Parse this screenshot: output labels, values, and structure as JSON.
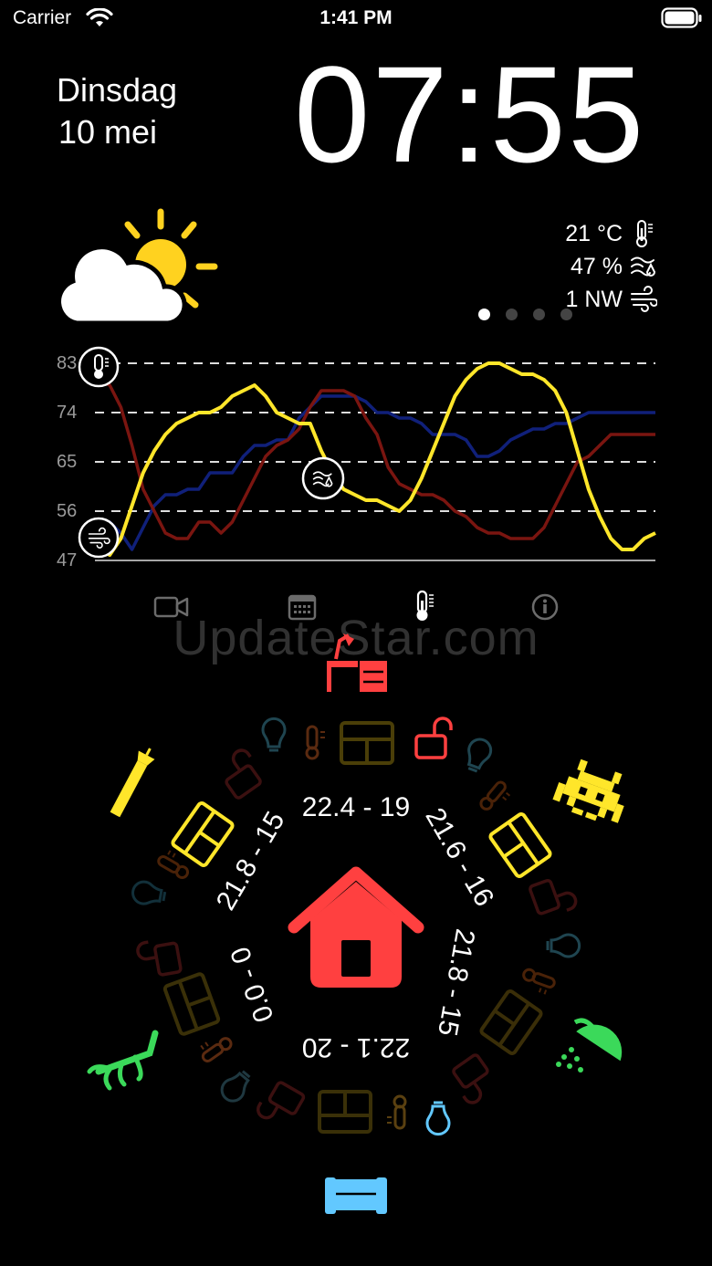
{
  "status_bar": {
    "carrier": "Carrier",
    "time": "1:41 PM"
  },
  "header": {
    "day": "Dinsdag",
    "date": "10 mei",
    "clock": "07:55"
  },
  "weather": {
    "condition_icon": "partly-cloudy-sun-icon",
    "temperature": "21 °C",
    "humidity": "47 %",
    "wind": "1 NW",
    "pager_pages": 4,
    "pager_active": 0
  },
  "chart_data": {
    "type": "line",
    "y_ticks": [
      "83",
      "74",
      "65",
      "56",
      "47"
    ],
    "ylim": [
      47,
      83
    ],
    "grid": "dashed-horizontal",
    "series": [
      {
        "color": "#ffe62a",
        "values": [
          49,
          48,
          51,
          57,
          63,
          67,
          70,
          72,
          73,
          74,
          74,
          75,
          77,
          78,
          79,
          77,
          74,
          73,
          72,
          72,
          67,
          63,
          60,
          59,
          58,
          58,
          57,
          56,
          58,
          62,
          67,
          72,
          77,
          80,
          82,
          83,
          83,
          82,
          81,
          81,
          80,
          78,
          74,
          67,
          60,
          55,
          51,
          49,
          49,
          51,
          52
        ]
      },
      {
        "color": "#7a1510",
        "values": [
          80,
          79,
          75,
          68,
          60,
          56,
          52,
          51,
          51,
          54,
          54,
          52,
          54,
          58,
          62,
          66,
          68,
          69,
          71,
          75,
          78,
          78,
          78,
          77,
          73,
          70,
          64,
          61,
          60,
          59,
          59,
          58,
          56,
          55,
          53,
          52,
          52,
          51,
          51,
          51,
          53,
          57,
          61,
          65,
          66,
          68,
          70,
          70,
          70,
          70,
          70
        ]
      },
      {
        "color": "#10207a",
        "values": [
          51,
          54,
          52,
          49,
          53,
          57,
          59,
          59,
          60,
          60,
          63,
          63,
          63,
          66,
          68,
          68,
          69,
          69,
          73,
          75,
          77,
          77,
          77,
          77,
          76,
          74,
          74,
          73,
          73,
          72,
          70,
          70,
          70,
          69,
          66,
          66,
          67,
          69,
          70,
          71,
          71,
          72,
          72,
          73,
          74,
          74,
          74,
          74,
          74,
          74,
          74
        ]
      }
    ]
  },
  "markers": [
    "thermometer-marker-icon",
    "wind-marker-icon",
    "humidity-marker-icon"
  ],
  "tabs": [
    {
      "icon": "video-camera-icon",
      "active": false
    },
    {
      "icon": "calendar-icon",
      "active": false
    },
    {
      "icon": "thermometer-icon",
      "active": true
    },
    {
      "icon": "info-icon",
      "active": false
    }
  ],
  "watermark": "UpdateStar.com",
  "home": {
    "center_icon": "house-icon",
    "rooms": [
      {
        "name_icon": "desk-lamp-icon",
        "color": "#ff4040"
      },
      {
        "name_icon": "space-invader-icon",
        "color": "#ffe62a"
      },
      {
        "name_icon": "shower-icon",
        "color": "#3bd95a"
      },
      {
        "name_icon": "sofa-icon",
        "color": "#62c8ff"
      },
      {
        "name_icon": "plant-icon",
        "color": "#3bd95a"
      },
      {
        "name_icon": "lamp-torch-icon",
        "color": "#ffe62a"
      }
    ],
    "ranges": [
      "22.4 - 19",
      "21.6 - 16",
      "21.8 - 15",
      "22.1 - 20",
      "0.0 - 0",
      "21.8 - 15"
    ],
    "colors": {
      "red": "#ff4040",
      "yellow": "#ffe62a",
      "green": "#3bd95a",
      "blue": "#62c8ff"
    }
  }
}
